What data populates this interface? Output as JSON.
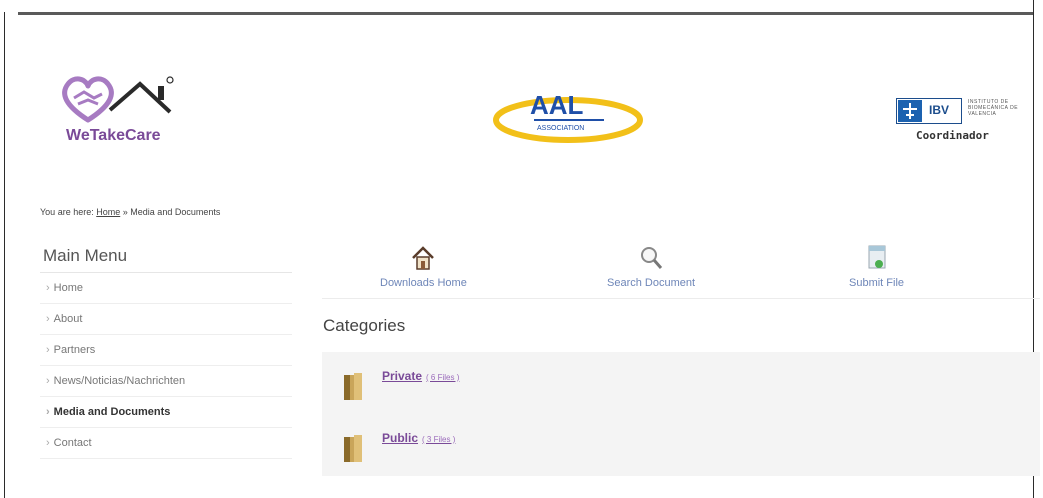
{
  "header": {
    "logos": {
      "wetakecare": {
        "text": "WeTakeCare",
        "icon": "hands-house-logo-icon"
      },
      "aal": {
        "text": "AAL",
        "subtext": "ASSOCIATION",
        "icon": "aal-logo-icon"
      },
      "ibv": {
        "letters": "IBV",
        "small_text": "INSTITUTO DE BIOMECÁNICA DE VALENCIA",
        "label": "Coordinador",
        "icon": "ibv-logo-icon"
      }
    }
  },
  "breadcrumb": {
    "prefix": "You are here:",
    "home": "Home",
    "separator": "»",
    "current": "Media and Documents"
  },
  "sidebar": {
    "title": "Main Menu",
    "items": [
      {
        "label": "Home",
        "active": false
      },
      {
        "label": "About",
        "active": false
      },
      {
        "label": "Partners",
        "active": false
      },
      {
        "label": "News/Noticias/Nachrichten",
        "active": false
      },
      {
        "label": "Media and Documents",
        "active": true
      },
      {
        "label": "Contact",
        "active": false
      }
    ]
  },
  "toolbar": {
    "items": [
      {
        "label": "Downloads Home",
        "icon": "home-icon"
      },
      {
        "label": "Search Document",
        "icon": "magnifier-icon"
      },
      {
        "label": "Submit File",
        "icon": "submit-file-icon"
      }
    ]
  },
  "categories": {
    "heading": "Categories",
    "items": [
      {
        "name": "Private",
        "count": "( 6 Files )"
      },
      {
        "name": "Public",
        "count": "( 3 Files )"
      }
    ]
  },
  "colors": {
    "brand_purple": "#7a4a98",
    "link_blue": "#6e86b8",
    "aal_yellow": "#f2c019",
    "aal_blue": "#1f4fa8",
    "ibv_blue": "#1c62b0"
  }
}
